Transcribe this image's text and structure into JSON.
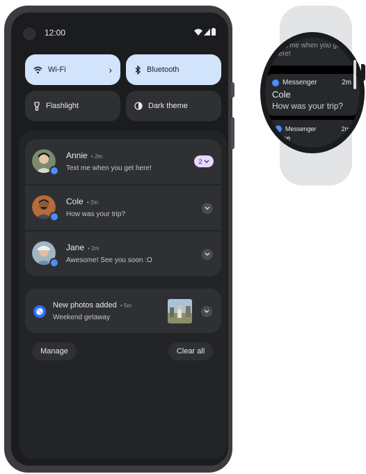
{
  "phone": {
    "status_bar": {
      "time": "12:00"
    },
    "quick_settings": [
      {
        "label": "Wi-Fi",
        "icon": "wifi-icon",
        "active": true,
        "has_chevron": true
      },
      {
        "label": "Bluetooth",
        "icon": "bluetooth-icon",
        "active": true
      },
      {
        "label": "Flashlight",
        "icon": "flashlight-icon",
        "active": false
      },
      {
        "label": "Dark theme",
        "icon": "dark-theme-icon",
        "active": false
      }
    ],
    "conversations": [
      {
        "name": "Annie",
        "time": "2m",
        "message": "Text me when you get here!",
        "count": "2"
      },
      {
        "name": "Cole",
        "time": "2m",
        "message": "How was your trip?"
      },
      {
        "name": "Jane",
        "time": "2m",
        "message": "Awesome! See you soon :O"
      }
    ],
    "photos_notification": {
      "title": "New photos added",
      "time": "5m",
      "subtitle": "Weekend getaway"
    },
    "buttons": {
      "manage": "Manage",
      "clear_all": "Clear all"
    },
    "colors": {
      "tile_active": "#d2e3fc",
      "count_badge": "#e7d6ff",
      "messages_icon": "#4b8ef8"
    }
  },
  "watch": {
    "previous_card_text": "Text me when you get here!",
    "main_card": {
      "app": "Messenger",
      "time": "2m",
      "sender": "Cole",
      "message": "How was your trip?"
    },
    "next_card": {
      "app": "Messenger",
      "time": "2m",
      "sender_partial": "ane"
    }
  }
}
